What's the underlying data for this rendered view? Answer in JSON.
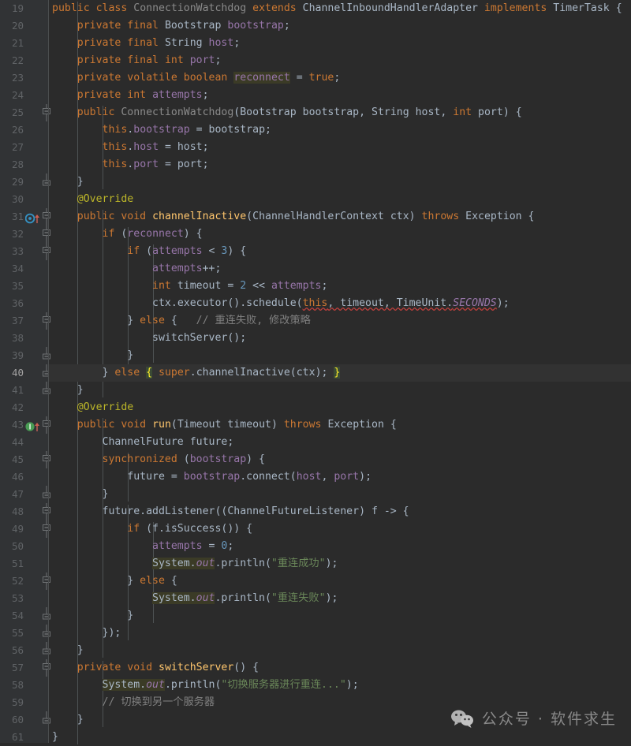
{
  "editor": {
    "language": "Java",
    "theme": "Darcula",
    "first_line_number": 19,
    "current_line_number": 40,
    "colors": {
      "background": "#2b2b2b",
      "gutter_background": "#313335",
      "current_line_background": "#323232",
      "keyword": "#cc7832",
      "string": "#6a8759",
      "number": "#6897bb",
      "comment": "#808080",
      "annotation": "#bbb529",
      "field": "#9876aa",
      "method_declaration": "#ffc66d",
      "plain_text": "#a9b7c6",
      "line_number": "#606366",
      "identifier_highlight": "#3b3b26",
      "matching_brace": "#3a4a35",
      "error_squiggle": "#bc3f3c",
      "override_marker": "#3592c4",
      "implement_marker": "#499c54"
    },
    "lines": [
      {
        "n": 19,
        "text": "public class ConnectionWatchdog extends ChannelInboundHandlerAdapter implements TimerTask {",
        "marker": null,
        "fold": "none"
      },
      {
        "n": 20,
        "text": "    private final Bootstrap bootstrap;",
        "marker": null,
        "fold": "none"
      },
      {
        "n": 21,
        "text": "    private final String host;",
        "marker": null,
        "fold": "none"
      },
      {
        "n": 22,
        "text": "    private final int port;",
        "marker": null,
        "fold": "none"
      },
      {
        "n": 23,
        "text": "    private volatile boolean reconnect = true;",
        "marker": null,
        "fold": "none"
      },
      {
        "n": 24,
        "text": "    private int attempts;",
        "marker": null,
        "fold": "none"
      },
      {
        "n": 25,
        "text": "    public ConnectionWatchdog(Bootstrap bootstrap, String host, int port) {",
        "marker": null,
        "fold": "start"
      },
      {
        "n": 26,
        "text": "        this.bootstrap = bootstrap;",
        "marker": null,
        "fold": "none"
      },
      {
        "n": 27,
        "text": "        this.host = host;",
        "marker": null,
        "fold": "none"
      },
      {
        "n": 28,
        "text": "        this.port = port;",
        "marker": null,
        "fold": "none"
      },
      {
        "n": 29,
        "text": "    }",
        "marker": null,
        "fold": "end"
      },
      {
        "n": 30,
        "text": "    @Override",
        "marker": null,
        "fold": "none"
      },
      {
        "n": 31,
        "text": "    public void channelInactive(ChannelHandlerContext ctx) throws Exception {",
        "marker": "override",
        "fold": "start"
      },
      {
        "n": 32,
        "text": "        if (reconnect) {",
        "marker": null,
        "fold": "start"
      },
      {
        "n": 33,
        "text": "            if (attempts < 3) {",
        "marker": null,
        "fold": "start"
      },
      {
        "n": 34,
        "text": "                attempts++;",
        "marker": null,
        "fold": "none"
      },
      {
        "n": 35,
        "text": "                int timeout = 2 << attempts;",
        "marker": null,
        "fold": "none"
      },
      {
        "n": 36,
        "text": "                ctx.executor().schedule(this, timeout, TimeUnit.SECONDS);",
        "marker": null,
        "fold": "none"
      },
      {
        "n": 37,
        "text": "            } else {   // 重连失败, 修改策略",
        "marker": null,
        "fold": "start"
      },
      {
        "n": 38,
        "text": "                switchServer();",
        "marker": null,
        "fold": "none"
      },
      {
        "n": 39,
        "text": "            }",
        "marker": null,
        "fold": "end"
      },
      {
        "n": 40,
        "text": "        } else { super.channelInactive(ctx); }",
        "marker": null,
        "fold": "end"
      },
      {
        "n": 41,
        "text": "    }",
        "marker": null,
        "fold": "end"
      },
      {
        "n": 42,
        "text": "    @Override",
        "marker": null,
        "fold": "none"
      },
      {
        "n": 43,
        "text": "    public void run(Timeout timeout) throws Exception {",
        "marker": "implement",
        "fold": "start"
      },
      {
        "n": 44,
        "text": "        ChannelFuture future;",
        "marker": null,
        "fold": "none"
      },
      {
        "n": 45,
        "text": "        synchronized (bootstrap) {",
        "marker": null,
        "fold": "start"
      },
      {
        "n": 46,
        "text": "            future = bootstrap.connect(host, port);",
        "marker": null,
        "fold": "none"
      },
      {
        "n": 47,
        "text": "        }",
        "marker": null,
        "fold": "end"
      },
      {
        "n": 48,
        "text": "        future.addListener((ChannelFutureListener) f -> {",
        "marker": null,
        "fold": "start"
      },
      {
        "n": 49,
        "text": "            if (f.isSuccess()) {",
        "marker": null,
        "fold": "start"
      },
      {
        "n": 50,
        "text": "                attempts = 0;",
        "marker": null,
        "fold": "none"
      },
      {
        "n": 51,
        "text": "                System.out.println(\"重连成功\");",
        "marker": null,
        "fold": "none"
      },
      {
        "n": 52,
        "text": "            } else {",
        "marker": null,
        "fold": "start"
      },
      {
        "n": 53,
        "text": "                System.out.println(\"重连失败\");",
        "marker": null,
        "fold": "none"
      },
      {
        "n": 54,
        "text": "            }",
        "marker": null,
        "fold": "end"
      },
      {
        "n": 55,
        "text": "        });",
        "marker": null,
        "fold": "end"
      },
      {
        "n": 56,
        "text": "    }",
        "marker": null,
        "fold": "end"
      },
      {
        "n": 57,
        "text": "    private void switchServer() {",
        "marker": null,
        "fold": "start"
      },
      {
        "n": 58,
        "text": "        System.out.println(\"切换服务器进行重连...\");",
        "marker": null,
        "fold": "none"
      },
      {
        "n": 59,
        "text": "        // 切换到另一个服务器",
        "marker": null,
        "fold": "none"
      },
      {
        "n": 60,
        "text": "    }",
        "marker": null,
        "fold": "end"
      },
      {
        "n": 61,
        "text": "}",
        "marker": null,
        "fold": "none"
      }
    ]
  },
  "watermark": {
    "icon": "wechat-icon",
    "text": "公众号 · 软件求生"
  }
}
